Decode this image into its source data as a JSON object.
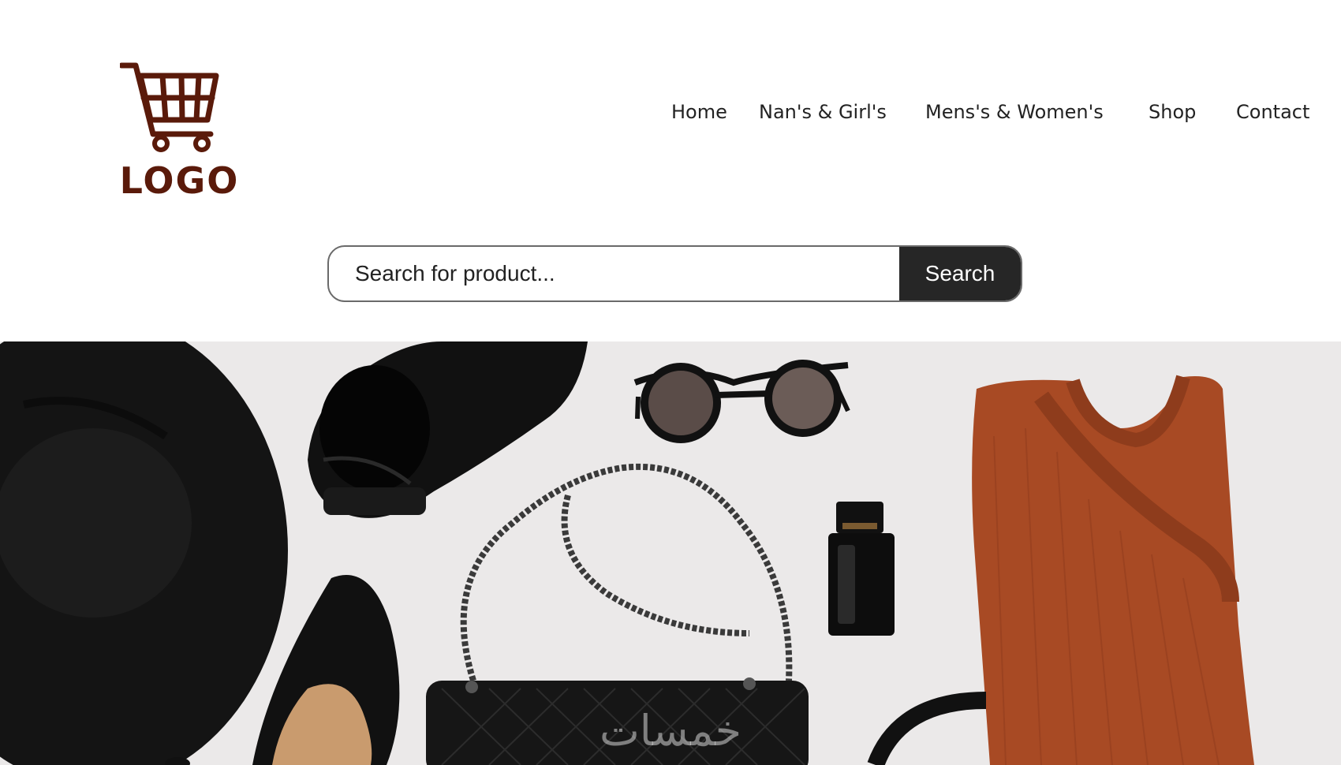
{
  "colors": {
    "brand": "#5a1a0a",
    "search_button_bg": "#262626",
    "hero_bg": "#ebe9e9",
    "sweater": "#a84a24"
  },
  "logo": {
    "text": "LOGO",
    "icon": "shopping-cart-icon"
  },
  "nav": {
    "items": [
      {
        "label": "Home"
      },
      {
        "label": "Nan's & Girl's"
      },
      {
        "label": "Mens's & Women's"
      },
      {
        "label": "Shop"
      },
      {
        "label": "Contact"
      }
    ]
  },
  "search": {
    "placeholder": "Search for product...",
    "value": "",
    "button_label": "Search",
    "icon": "search-icon"
  },
  "hero": {
    "items": [
      "hat",
      "ankle-boot",
      "sunglasses",
      "sweater",
      "chain-bag",
      "perfume-bottle",
      "high-heel-shoe",
      "headband"
    ]
  },
  "watermark": {
    "text": "خمسات"
  }
}
